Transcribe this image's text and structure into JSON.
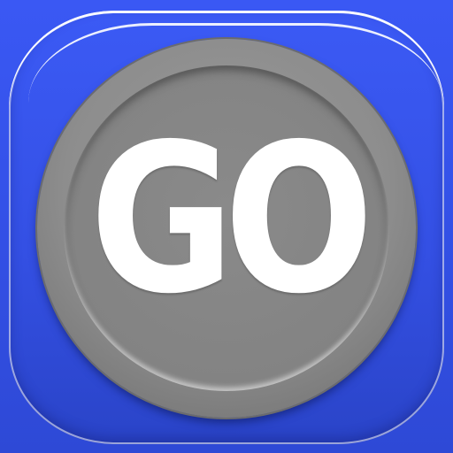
{
  "button": {
    "label": "GO"
  },
  "colors": {
    "background": "#3a55ee",
    "button_face": "#8a8a8a",
    "label": "#ffffff"
  }
}
